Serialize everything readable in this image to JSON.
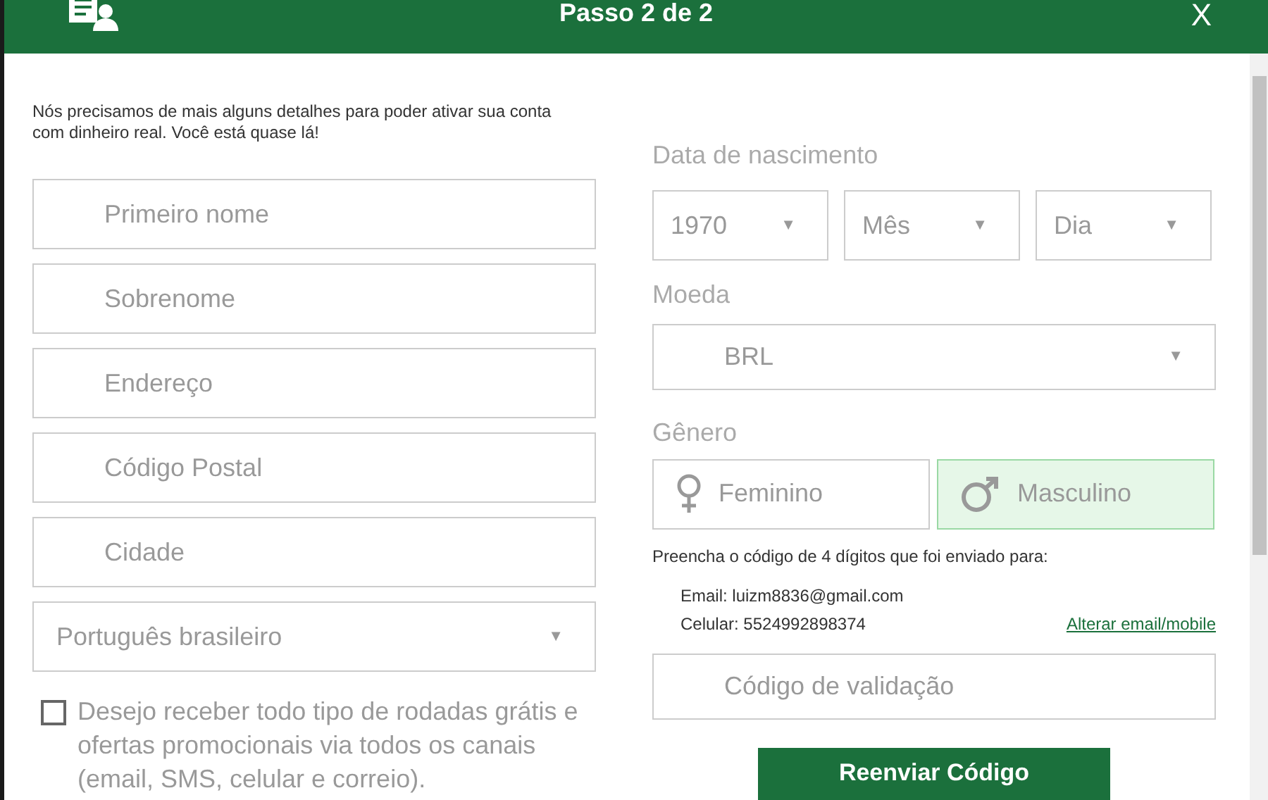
{
  "header": {
    "title": "Passo 2 de 2",
    "close": "X"
  },
  "intro": "Nós precisamos de mais alguns detalhes para poder ativar sua conta com dinheiro real. Você está quase lá!",
  "fields": [
    {
      "placeholder": "Primeiro nome"
    },
    {
      "placeholder": "Sobrenome"
    },
    {
      "placeholder": "Endereço"
    },
    {
      "placeholder": "Código Postal"
    },
    {
      "placeholder": "Cidade"
    }
  ],
  "language": {
    "value": "Português brasileiro",
    "arrow": "▼"
  },
  "consent": {
    "checked": false,
    "label": "Desejo receber todo tipo de rodadas grátis e ofertas promocionais via todos os canais (email, SMS, celular e correio)."
  },
  "birth": {
    "label": "Data de nascimento",
    "selects": [
      {
        "value": "1970",
        "arrow": "▼"
      },
      {
        "value": "Mês",
        "arrow": "▼"
      },
      {
        "value": "Dia",
        "arrow": "▼"
      }
    ]
  },
  "currency": {
    "label": "Moeda",
    "value": "BRL",
    "arrow": "▼"
  },
  "gender": {
    "label": "Gênero",
    "options": [
      {
        "kind": "female",
        "label": "Feminino",
        "selected": false
      },
      {
        "kind": "male",
        "label": "Masculino",
        "selected": true
      }
    ]
  },
  "verification": {
    "prompt": "Preencha o código de 4 dígitos que foi enviado para:",
    "email": "Email: luizm8836@gmail.com",
    "phone": "Celular: 5524992898374",
    "change_link": "Alterar email/mobile",
    "code_placeholder": "Código de validação",
    "resend": "Reenviar Código"
  }
}
